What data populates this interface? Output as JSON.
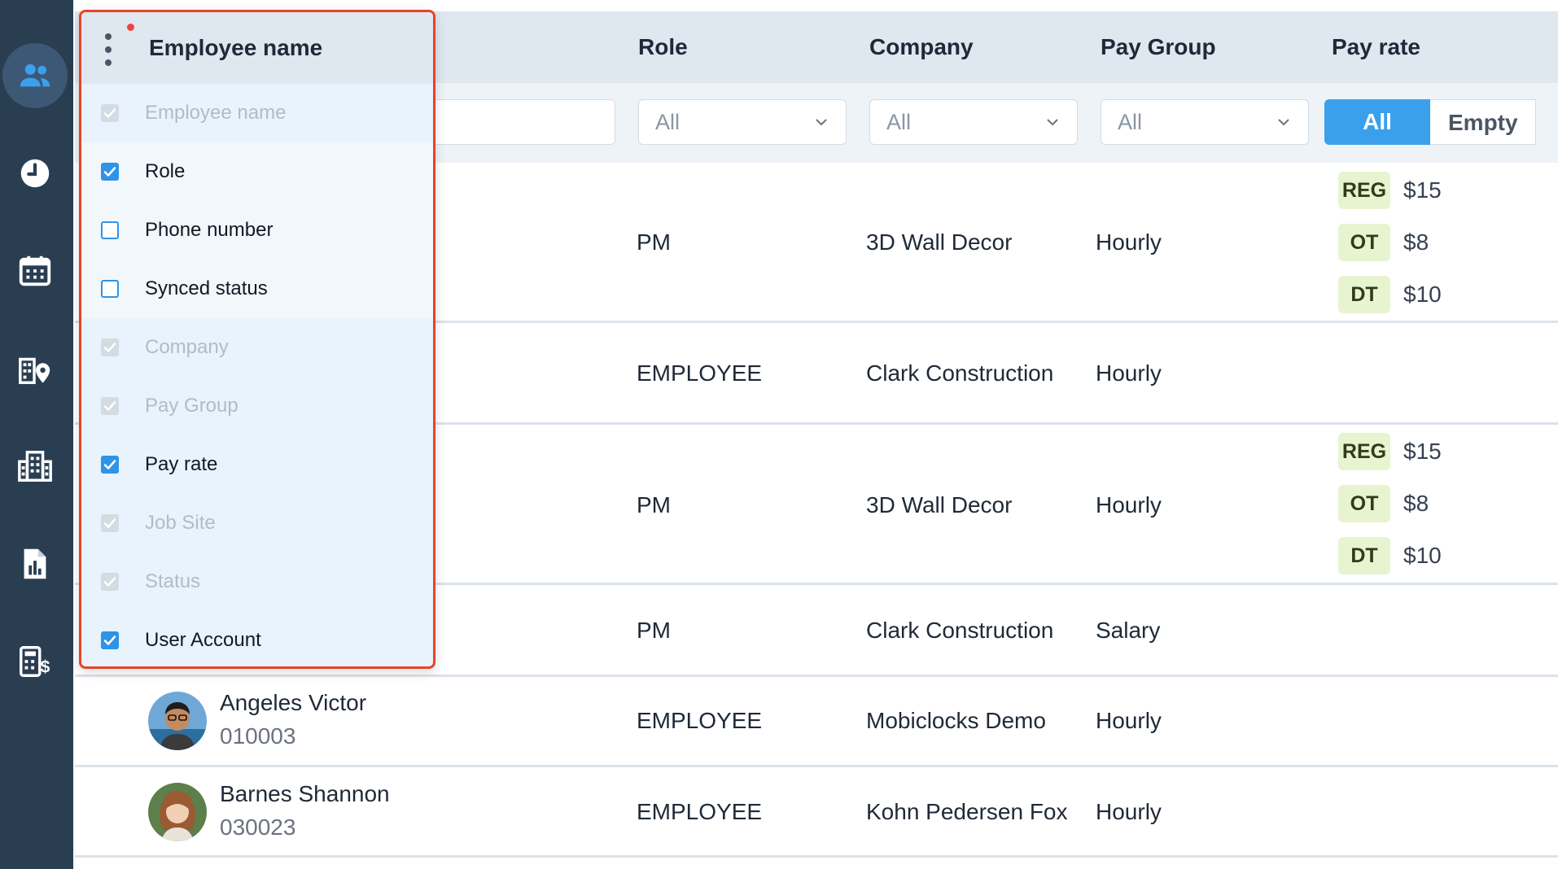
{
  "sidebar": {
    "items": [
      {
        "icon": "people-icon",
        "active": true
      },
      {
        "icon": "clock-icon",
        "active": false
      },
      {
        "icon": "calendar-icon",
        "active": false
      },
      {
        "icon": "job-site-location-icon",
        "active": false
      },
      {
        "icon": "building-icon",
        "active": false
      },
      {
        "icon": "report-chart-icon",
        "active": false
      },
      {
        "icon": "payroll-calculator-icon",
        "active": false
      }
    ]
  },
  "table": {
    "columns": {
      "role": "Role",
      "company": "Company",
      "pay_group": "Pay Group",
      "pay_rate": "Pay rate"
    },
    "filters": {
      "role": "All",
      "company": "All",
      "pay_group": "All",
      "pay_rate_options": [
        "All",
        "Empty"
      ]
    },
    "rows": [
      {
        "role": "PM",
        "company": "3D Wall Decor",
        "pay_group": "Hourly",
        "rates": [
          {
            "type": "REG",
            "amount": "$15"
          },
          {
            "type": "OT",
            "amount": "$8"
          },
          {
            "type": "DT",
            "amount": "$10"
          }
        ]
      },
      {
        "role": "EMPLOYEE",
        "company": "Clark Construction",
        "pay_group": "Hourly",
        "rates": []
      },
      {
        "role": "PM",
        "company": "3D Wall Decor",
        "pay_group": "Hourly",
        "rates": [
          {
            "type": "REG",
            "amount": "$15"
          },
          {
            "type": "OT",
            "amount": "$8"
          },
          {
            "type": "DT",
            "amount": "$10"
          }
        ]
      },
      {
        "role": "PM",
        "company": "Clark Construction",
        "pay_group": "Salary",
        "rates": []
      },
      {
        "name": "Angeles Victor",
        "id": "010003",
        "role": "EMPLOYEE",
        "company": "Mobiclocks Demo",
        "pay_group": "Hourly",
        "rates": []
      },
      {
        "name": "Barnes Shannon",
        "id": "030023",
        "role": "EMPLOYEE",
        "company": "Kohn Pedersen Fox",
        "pay_group": "Hourly",
        "rates": []
      }
    ]
  },
  "column_picker": {
    "title": "Employee name",
    "options": [
      {
        "label": "Employee name",
        "state": "disabled"
      },
      {
        "label": "Role",
        "state": "checked"
      },
      {
        "label": "Phone number",
        "state": "unchecked"
      },
      {
        "label": "Synced status",
        "state": "unchecked"
      },
      {
        "label": "Company",
        "state": "disabled"
      },
      {
        "label": "Pay Group",
        "state": "disabled"
      },
      {
        "label": "Pay rate",
        "state": "checked"
      },
      {
        "label": "Job Site",
        "state": "disabled"
      },
      {
        "label": "Status",
        "state": "disabled"
      },
      {
        "label": "User Account",
        "state": "checked"
      }
    ]
  },
  "colors": {
    "sidebar_bg": "#2a3e52",
    "accent_blue": "#3aa0ec",
    "picker_border": "#e8432a",
    "rate_badge_bg": "#e7f4cf"
  }
}
